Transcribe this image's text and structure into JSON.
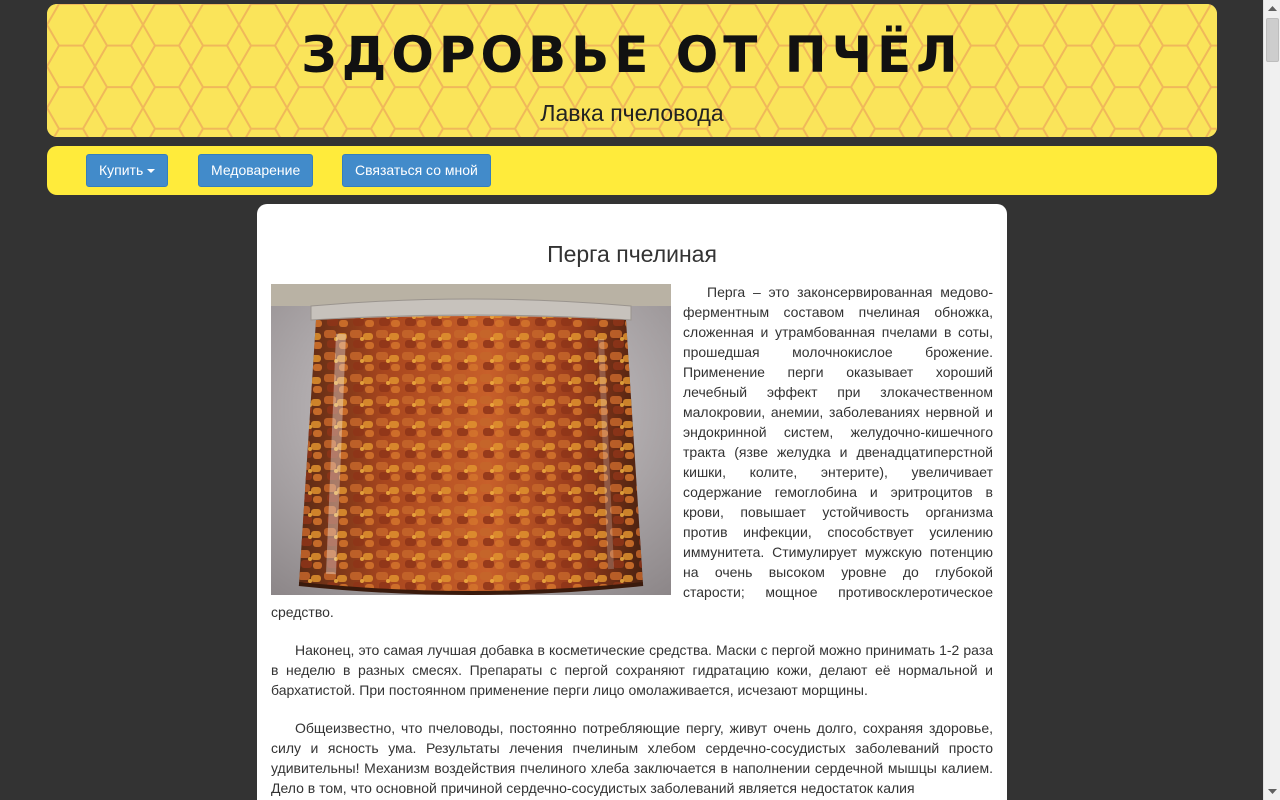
{
  "header": {
    "title": "ЗДОРОВЬЕ ОТ ПЧЁЛ",
    "subtitle": "Лавка пчеловода"
  },
  "nav": {
    "items": [
      {
        "label": "Купить",
        "has_dropdown": true
      },
      {
        "label": "Медоварение",
        "has_dropdown": false
      },
      {
        "label": "Связаться со мной",
        "has_dropdown": false
      }
    ]
  },
  "article": {
    "title": "Перга пчелиная",
    "image_alt": "jar of bee bread",
    "paragraphs": [
      "Перга – это законсервированная медово-ферментным составом пчелиная обножка, сложенная и утрамбованная пчелами в соты, прошедшая молочнокислое брожение. Применение перги оказывает хороший лечебный эффект при злокачественном малокровии, анемии, заболеваниях нервной и эндокринной систем, желудочно-кишечного тракта (язве желудка и двенадцатиперстной кишки, колите, энтерите), увеличивает содержание гемоглобина и эритроцитов в крови, повышает устойчивость организма против инфекции, способствует усилению иммунитета. Стимулирует мужскую потенцию на очень высоком уровне до глубокой старости; мощное противосклеротическое средство.",
      "Наконец, это самая лучшая добавка в косметические средства. Маски с пергой можно принимать 1-2 раза в неделю в разных смесях. Препараты с пергой сохраняют гидратацию кожи, делают её нормальной и бархатистой. При постоянном применение перги лицо омолаживается, исчезают морщины.",
      "Общеизвестно, что пчеловоды, постоянно потребляющие пергу, живут очень долго, сохраняя здоровье, силу и ясность ума. Результаты лечения пчелиным хлебом сердечно-сосудистых заболеваний просто удивительны! Механизм воздействия пчелиного хлеба заключается в наполнении сердечной мышцы калием. Дело в том, что основной причиной сердечно-сосудистых заболеваний является недостаток калия"
    ]
  },
  "colors": {
    "page_bg": "#333333",
    "header_bg": "#fae45a",
    "nav_bg": "#ffeb3b",
    "button_bg": "#428bca",
    "content_bg": "#ffffff"
  }
}
